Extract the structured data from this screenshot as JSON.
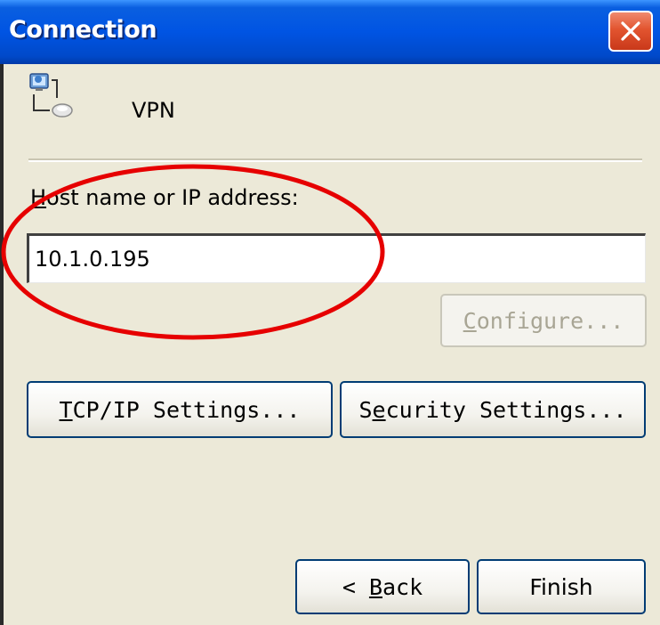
{
  "window": {
    "title": "Connection",
    "close_icon": "close-icon"
  },
  "connection": {
    "icon": "network-connection-icon",
    "name": "VPN"
  },
  "host": {
    "label_accel": "H",
    "label_rest": "ost name or IP address:",
    "value": "10.1.0.195"
  },
  "buttons": {
    "configure": {
      "accel": "C",
      "rest": "onfigure...",
      "enabled": false
    },
    "tcpip": {
      "accel": "T",
      "rest": "CP/IP Settings..."
    },
    "security": {
      "pre": "S",
      "accel": "e",
      "rest": "curity Settings..."
    },
    "back": {
      "pre": "< ",
      "accel": "B",
      "rest": "ack"
    },
    "finish": {
      "label": "Finish"
    }
  },
  "annotation": {
    "type": "highlight-ellipse",
    "color": "#e60000"
  },
  "colors": {
    "titlebar": "#0054e3",
    "window_bg": "#ece9d8",
    "close_button": "#e2542f",
    "disabled_text": "#a8a594"
  }
}
